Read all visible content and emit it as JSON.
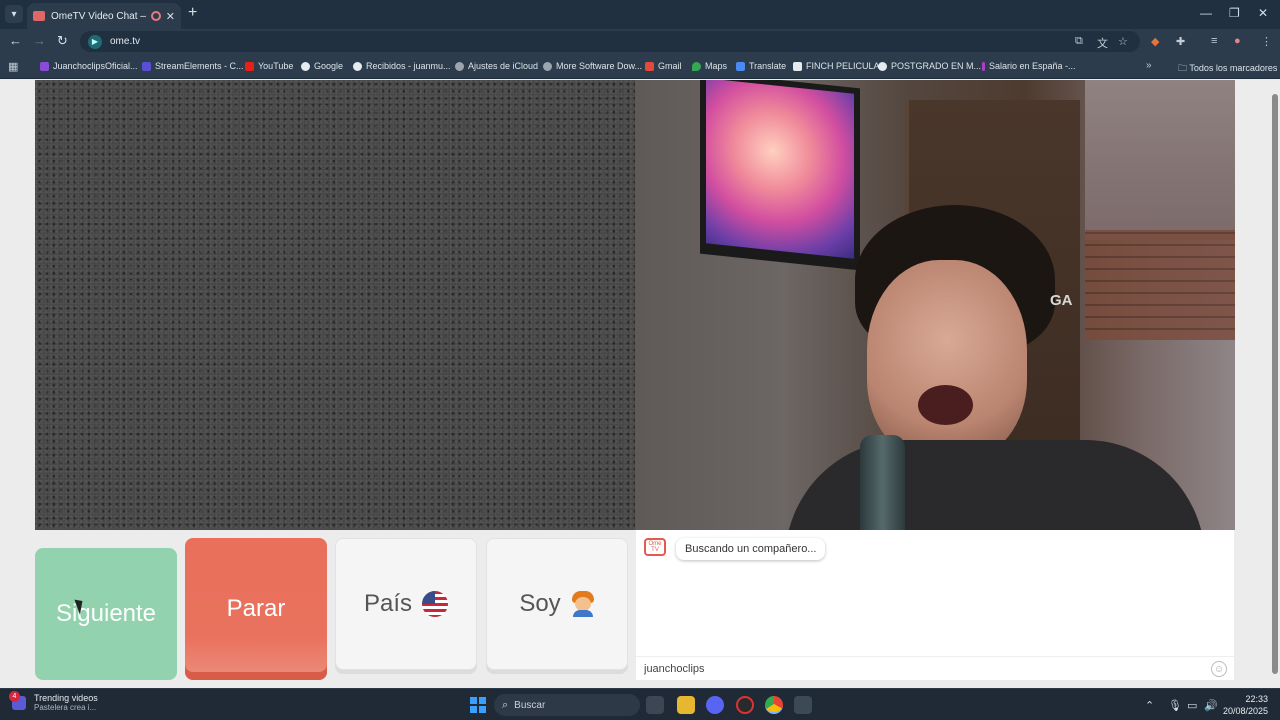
{
  "browser": {
    "tab_title": "OmeTV Video Chat — Omegle",
    "url": "ome.tv",
    "bookmarks": [
      {
        "label": "JuanchoclipsOficial...",
        "color": "#8a4bd8"
      },
      {
        "label": "StreamElements - C...",
        "color": "#5b4dd6"
      },
      {
        "label": "YouTube",
        "color": "#e62117"
      },
      {
        "label": "Google",
        "color": "#e6ebf0"
      },
      {
        "label": "Recibidos - juanmu...",
        "color": "#e6ebf0"
      },
      {
        "label": "Ajustes de iCloud",
        "color": "#9aa5b0"
      },
      {
        "label": "More Software Dow...",
        "color": "#9aa5b0"
      },
      {
        "label": "Gmail",
        "color": "#e24a3b"
      },
      {
        "label": "Maps",
        "color": "#34a853"
      },
      {
        "label": "Translate",
        "color": "#4a8af4"
      },
      {
        "label": "FINCH PELICULA",
        "color": "#e6ebf0"
      },
      {
        "label": "POSTGRADO EN M...",
        "color": "#e6ebf0"
      },
      {
        "label": "Salario en España -...",
        "color": "#b03cc8"
      }
    ],
    "bookmarks_folder": "Todos los marcadores"
  },
  "video": {
    "chair_logo_text": "GA"
  },
  "buttons": {
    "next": "Siguiente",
    "stop": "Parar",
    "country": "País",
    "gender": "Soy"
  },
  "chat": {
    "logo_text": "Ome TV",
    "status_message": "Buscando un compañero...",
    "input_value": "juanchoclips"
  },
  "taskbar": {
    "widget_badge": "4",
    "widget_title": "Trending videos",
    "widget_subtitle": "Pastelera crea i...",
    "search_placeholder": "Buscar",
    "time": "22:33",
    "date": "20/08/2025"
  },
  "colors": {
    "next_button": "#8ed1ab",
    "stop_button": "#e9705b",
    "chrome_dark": "#203040"
  }
}
